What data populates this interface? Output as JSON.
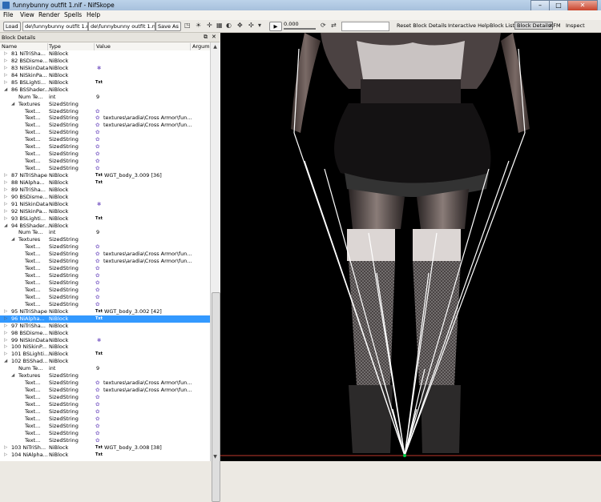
{
  "window": {
    "title": "funnybunny outfit 1.nif - NifSkope"
  },
  "menu": [
    "File",
    "View",
    "Render",
    "Spells",
    "Help"
  ],
  "toolbar": {
    "load_label": "Load",
    "load_path": "de\\funnybunny outfit 1.nif",
    "save_path": "de\\funnybunny outfit 1.nif",
    "saveas_label": "Save As",
    "time_value": "0.000",
    "reset_label": "Reset Block Details",
    "help_label": "Interactive Help",
    "blocklist_label": "Block List",
    "blockdetails_label": "Block Details",
    "kfm_label": "KFM",
    "inspect_label": "Inspect"
  },
  "panel": {
    "title": "Block Details"
  },
  "columns": [
    "Name",
    "Type",
    "Value",
    "Argum"
  ],
  "rows": [
    {
      "arrow": "▷",
      "name": "81 NiTriSha...",
      "type": "NiBlock",
      "value": "",
      "level": 0
    },
    {
      "arrow": "▷",
      "name": "82 BSDisme...",
      "type": "NiBlock",
      "value": "",
      "level": 0
    },
    {
      "arrow": "▷",
      "name": "83 NiSkinData",
      "type": "NiBlock",
      "value": "",
      "icon": "✱",
      "level": 0
    },
    {
      "arrow": "▷",
      "name": "84 NiSkinPa...",
      "type": "NiBlock",
      "value": "",
      "level": 0
    },
    {
      "arrow": "▷",
      "name": "85 BSLighti...",
      "type": "NiBlock",
      "value": "",
      "txt": "Txt",
      "level": 0
    },
    {
      "arrow": "◢",
      "name": "86 BSShader...",
      "type": "NiBlock",
      "value": "",
      "level": 0
    },
    {
      "arrow": "",
      "name": "Num Te...",
      "type": "int",
      "value": "9",
      "level": 1
    },
    {
      "arrow": "◢",
      "name": "Textures",
      "type": "SizedString",
      "value": "",
      "level": 1
    },
    {
      "arrow": "",
      "name": "Text...",
      "type": "SizedString",
      "value": "",
      "blob": true,
      "level": 2
    },
    {
      "arrow": "",
      "name": "Text...",
      "type": "SizedString",
      "value": "textures\\aradia\\Cross Armor\\fun...",
      "blob": true,
      "level": 2
    },
    {
      "arrow": "",
      "name": "Text...",
      "type": "SizedString",
      "value": "textures\\aradia\\Cross Armor\\fun...",
      "blob": true,
      "level": 2
    },
    {
      "arrow": "",
      "name": "Text...",
      "type": "SizedString",
      "value": "",
      "blob": true,
      "level": 2
    },
    {
      "arrow": "",
      "name": "Text...",
      "type": "SizedString",
      "value": "",
      "blob": true,
      "level": 2
    },
    {
      "arrow": "",
      "name": "Text...",
      "type": "SizedString",
      "value": "",
      "blob": true,
      "level": 2
    },
    {
      "arrow": "",
      "name": "Text...",
      "type": "SizedString",
      "value": "",
      "blob": true,
      "level": 2
    },
    {
      "arrow": "",
      "name": "Text...",
      "type": "SizedString",
      "value": "",
      "blob": true,
      "level": 2
    },
    {
      "arrow": "",
      "name": "Text...",
      "type": "SizedString",
      "value": "",
      "blob": true,
      "level": 2
    },
    {
      "arrow": "▷",
      "name": "87 NiTriShape",
      "type": "NiBlock",
      "value": "WGT_body_3.009 [36]",
      "txt": "Txt",
      "level": 0
    },
    {
      "arrow": "▷",
      "name": "88 NiAlpha...",
      "type": "NiBlock",
      "value": "",
      "txt": "Txt",
      "level": 0
    },
    {
      "arrow": "▷",
      "name": "89 NiTriSha...",
      "type": "NiBlock",
      "value": "",
      "level": 0
    },
    {
      "arrow": "▷",
      "name": "90 BSDisme...",
      "type": "NiBlock",
      "value": "",
      "level": 0
    },
    {
      "arrow": "▷",
      "name": "91 NiSkinData",
      "type": "NiBlock",
      "value": "",
      "icon": "✱",
      "level": 0
    },
    {
      "arrow": "▷",
      "name": "92 NiSkinPa...",
      "type": "NiBlock",
      "value": "",
      "level": 0
    },
    {
      "arrow": "▷",
      "name": "93 BSLighti...",
      "type": "NiBlock",
      "value": "",
      "txt": "Txt",
      "level": 0
    },
    {
      "arrow": "◢",
      "name": "94 BSShader...",
      "type": "NiBlock",
      "value": "",
      "level": 0
    },
    {
      "arrow": "",
      "name": "Num Te...",
      "type": "int",
      "value": "9",
      "level": 1
    },
    {
      "arrow": "◢",
      "name": "Textures",
      "type": "SizedString",
      "value": "",
      "level": 1
    },
    {
      "arrow": "",
      "name": "Text...",
      "type": "SizedString",
      "value": "",
      "blob": true,
      "level": 2
    },
    {
      "arrow": "",
      "name": "Text...",
      "type": "SizedString",
      "value": "textures\\aradia\\Cross Armor\\fun...",
      "blob": true,
      "level": 2
    },
    {
      "arrow": "",
      "name": "Text...",
      "type": "SizedString",
      "value": "textures\\aradia\\Cross Armor\\fun...",
      "blob": true,
      "level": 2
    },
    {
      "arrow": "",
      "name": "Text...",
      "type": "SizedString",
      "value": "",
      "blob": true,
      "level": 2
    },
    {
      "arrow": "",
      "name": "Text...",
      "type": "SizedString",
      "value": "",
      "blob": true,
      "level": 2
    },
    {
      "arrow": "",
      "name": "Text...",
      "type": "SizedString",
      "value": "",
      "blob": true,
      "level": 2
    },
    {
      "arrow": "",
      "name": "Text...",
      "type": "SizedString",
      "value": "",
      "blob": true,
      "level": 2
    },
    {
      "arrow": "",
      "name": "Text...",
      "type": "SizedString",
      "value": "",
      "blob": true,
      "level": 2
    },
    {
      "arrow": "",
      "name": "Text...",
      "type": "SizedString",
      "value": "",
      "blob": true,
      "level": 2
    },
    {
      "arrow": "▷",
      "name": "95 NiTriShape",
      "type": "NiBlock",
      "value": "WGT_body_3.002 [42]",
      "txt": "Txt",
      "level": 0
    },
    {
      "arrow": "▷",
      "name": "96 NiAlpha...",
      "type": "NiBlock",
      "value": "",
      "txt": "Txt",
      "level": 0,
      "selected": true
    },
    {
      "arrow": "▷",
      "name": "97 NiTriSha...",
      "type": "NiBlock",
      "value": "",
      "level": 0
    },
    {
      "arrow": "▷",
      "name": "98 BSDisme...",
      "type": "NiBlock",
      "value": "",
      "level": 0
    },
    {
      "arrow": "▷",
      "name": "99 NiSkinData",
      "type": "NiBlock",
      "value": "",
      "icon": "✱",
      "level": 0
    },
    {
      "arrow": "▷",
      "name": "100 NiSkinP...",
      "type": "NiBlock",
      "value": "",
      "level": 0
    },
    {
      "arrow": "▷",
      "name": "101 BSLighti...",
      "type": "NiBlock",
      "value": "",
      "txt": "Txt",
      "level": 0
    },
    {
      "arrow": "◢",
      "name": "102 BSShad...",
      "type": "NiBlock",
      "value": "",
      "level": 0
    },
    {
      "arrow": "",
      "name": "Num Te...",
      "type": "int",
      "value": "9",
      "level": 1
    },
    {
      "arrow": "◢",
      "name": "Textures",
      "type": "SizedString",
      "value": "",
      "level": 1
    },
    {
      "arrow": "",
      "name": "Text...",
      "type": "SizedString",
      "value": "textures\\aradia\\Cross Armor\\fun...",
      "blob": true,
      "level": 2
    },
    {
      "arrow": "",
      "name": "Text...",
      "type": "SizedString",
      "value": "textures\\aradia\\Cross Armor\\fun...",
      "blob": true,
      "level": 2
    },
    {
      "arrow": "",
      "name": "Text...",
      "type": "SizedString",
      "value": "",
      "blob": true,
      "level": 2
    },
    {
      "arrow": "",
      "name": "Text...",
      "type": "SizedString",
      "value": "",
      "blob": true,
      "level": 2
    },
    {
      "arrow": "",
      "name": "Text...",
      "type": "SizedString",
      "value": "",
      "blob": true,
      "level": 2
    },
    {
      "arrow": "",
      "name": "Text...",
      "type": "SizedString",
      "value": "",
      "blob": true,
      "level": 2
    },
    {
      "arrow": "",
      "name": "Text...",
      "type": "SizedString",
      "value": "",
      "blob": true,
      "level": 2
    },
    {
      "arrow": "",
      "name": "Text...",
      "type": "SizedString",
      "value": "",
      "blob": true,
      "level": 2
    },
    {
      "arrow": "",
      "name": "Text...",
      "type": "SizedString",
      "value": "",
      "blob": true,
      "level": 2
    },
    {
      "arrow": "▷",
      "name": "103 NiTriSh...",
      "type": "NiBlock",
      "value": "WGT_body_3.008 [38]",
      "txt": "Txt",
      "level": 0
    },
    {
      "arrow": "▷",
      "name": "104 NiAlpha...",
      "type": "NiBlock",
      "value": "",
      "txt": "Txt",
      "level": 0
    }
  ],
  "colors": {
    "selection": "#3399ff",
    "viewport_bg": "#000000",
    "bones": "#ffffff",
    "floor_line": "#c0392b"
  }
}
